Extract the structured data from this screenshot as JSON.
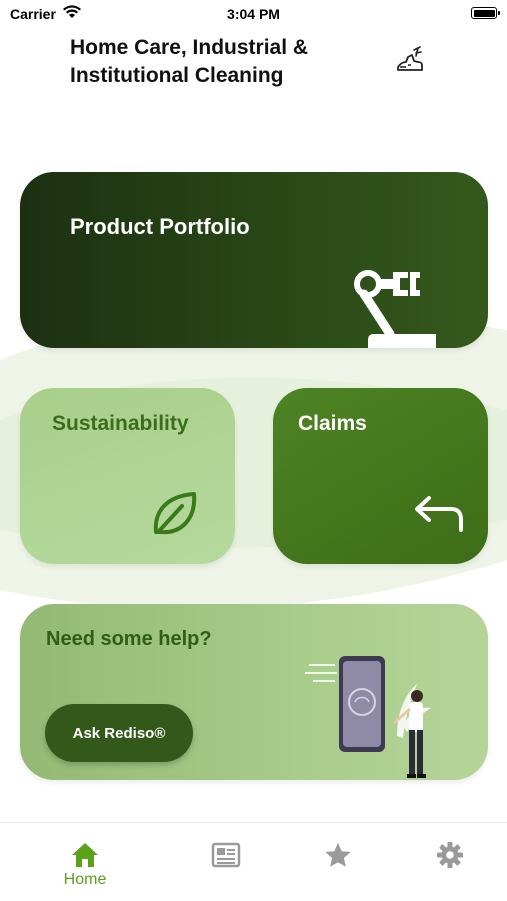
{
  "status_bar": {
    "carrier": "Carrier",
    "time": "3:04 PM"
  },
  "header": {
    "title": "Home Care, Industrial & Institutional Cleaning",
    "logo_icon": "shoe-icon"
  },
  "cards": {
    "portfolio": {
      "title": "Product Portfolio",
      "icon": "robot-arm-icon"
    },
    "sustainability": {
      "title": "Sustainability",
      "icon": "leaf-icon"
    },
    "claims": {
      "title": "Claims",
      "icon": "reply-arrow-icon"
    },
    "help": {
      "title": "Need some help?",
      "button_label": "Ask Rediso®",
      "illustration": "person-with-phone"
    }
  },
  "tab_bar": {
    "active": "home",
    "tabs": [
      {
        "id": "home",
        "label": "Home",
        "icon": "home-icon"
      },
      {
        "id": "news",
        "label": "",
        "icon": "newspaper-icon"
      },
      {
        "id": "favorites",
        "label": "",
        "icon": "star-icon"
      },
      {
        "id": "settings",
        "label": "",
        "icon": "gear-icon"
      }
    ]
  },
  "colors": {
    "accent": "#5aa21c",
    "dark_green": "#1c3011",
    "mid_green": "#4e8323",
    "light_green": "#a8cf8a",
    "inactive_icon": "#9a9a9a"
  }
}
